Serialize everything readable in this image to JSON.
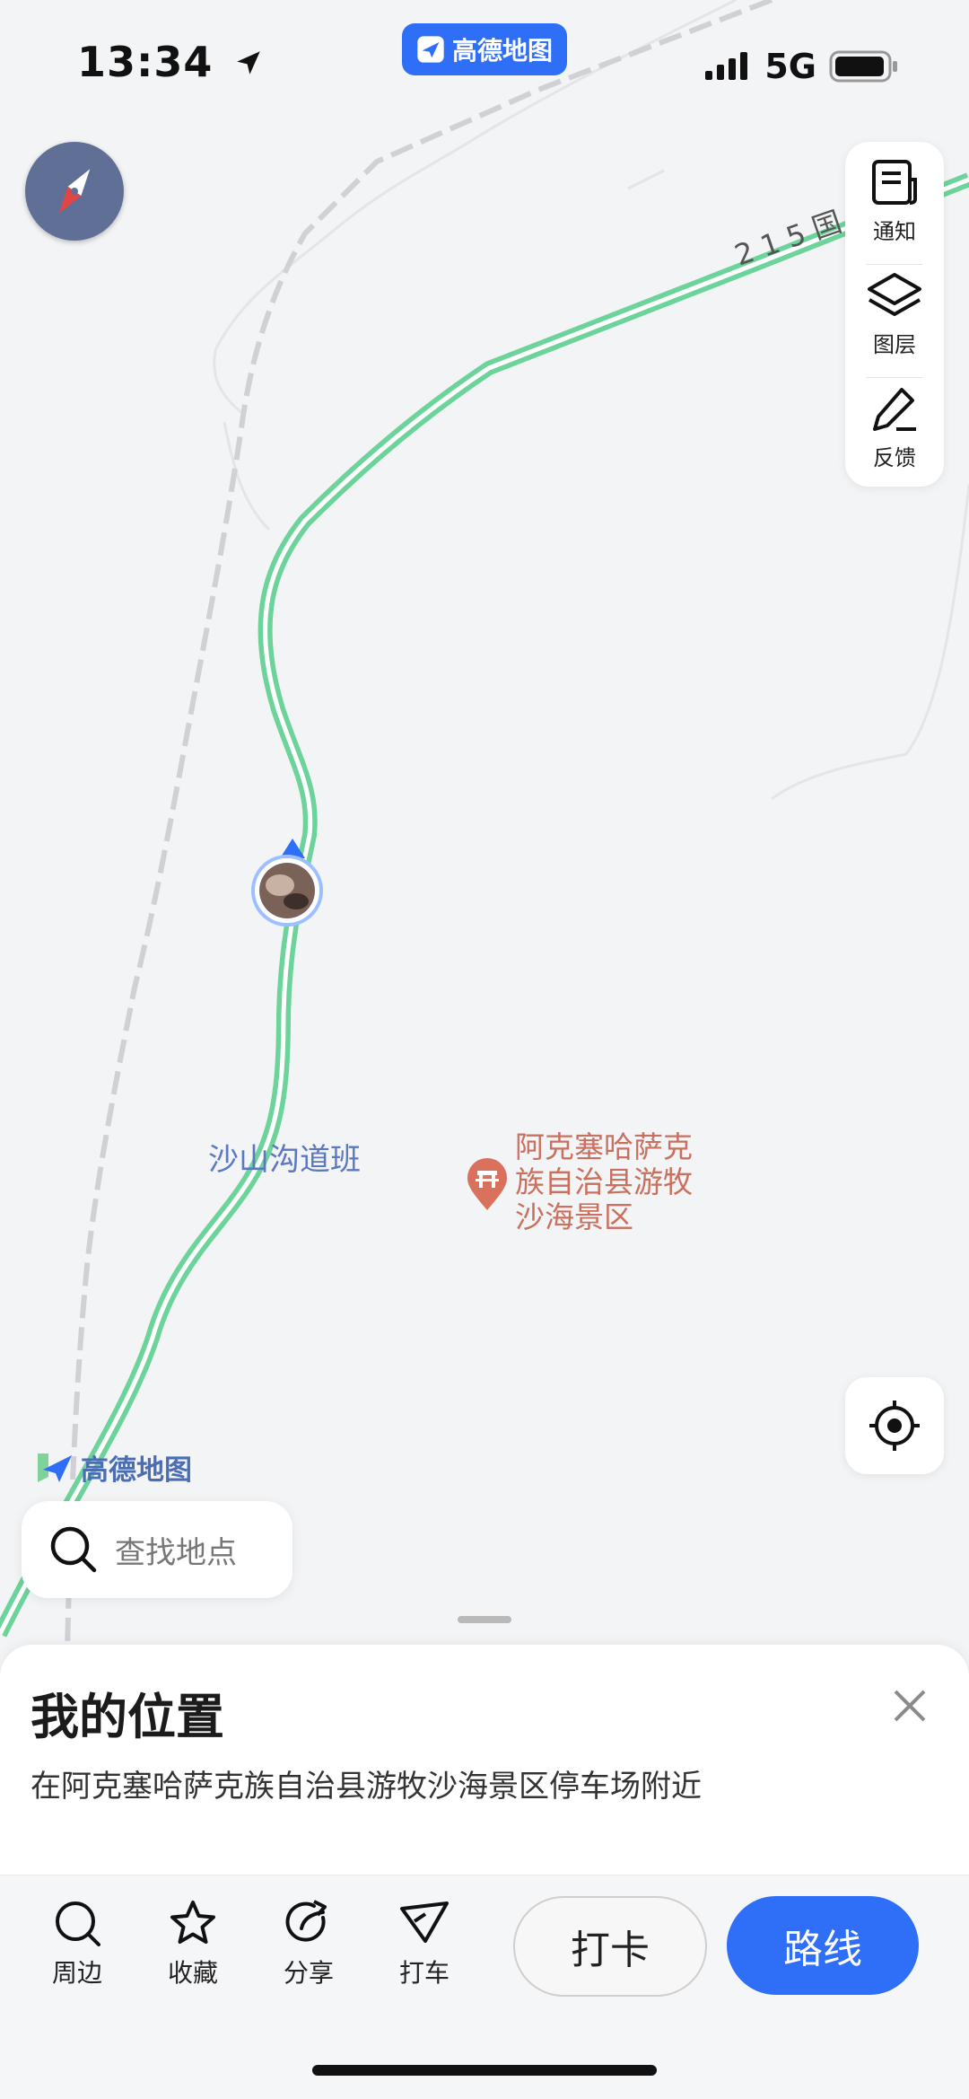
{
  "status_bar": {
    "time": "13:34",
    "network": "5G",
    "app_badge": "高德地图",
    "icons": [
      "location-arrow-icon",
      "signal-icon",
      "battery-icon"
    ]
  },
  "map": {
    "road_name": "215国",
    "place_label": "沙山沟道班",
    "poi_name": "阿克塞哈萨克族自治县游牧沙海景区",
    "poi_icon": "scenic-gate-icon",
    "logo_text": "高德地图",
    "route_color": "#6cd39a",
    "accent_color": "#2f6ef6"
  },
  "toolbar": {
    "notify_label": "通知",
    "layers_label": "图层",
    "feedback_label": "反馈"
  },
  "search": {
    "placeholder": "查找地点"
  },
  "sheet": {
    "title": "我的位置",
    "subtitle": "在阿克塞哈萨克族自治县游牧沙海景区停车场附近",
    "actions": {
      "nearby": "周边",
      "favorite": "收藏",
      "share": "分享",
      "taxi": "打车"
    },
    "checkin_label": "打卡",
    "route_label": "路线"
  }
}
